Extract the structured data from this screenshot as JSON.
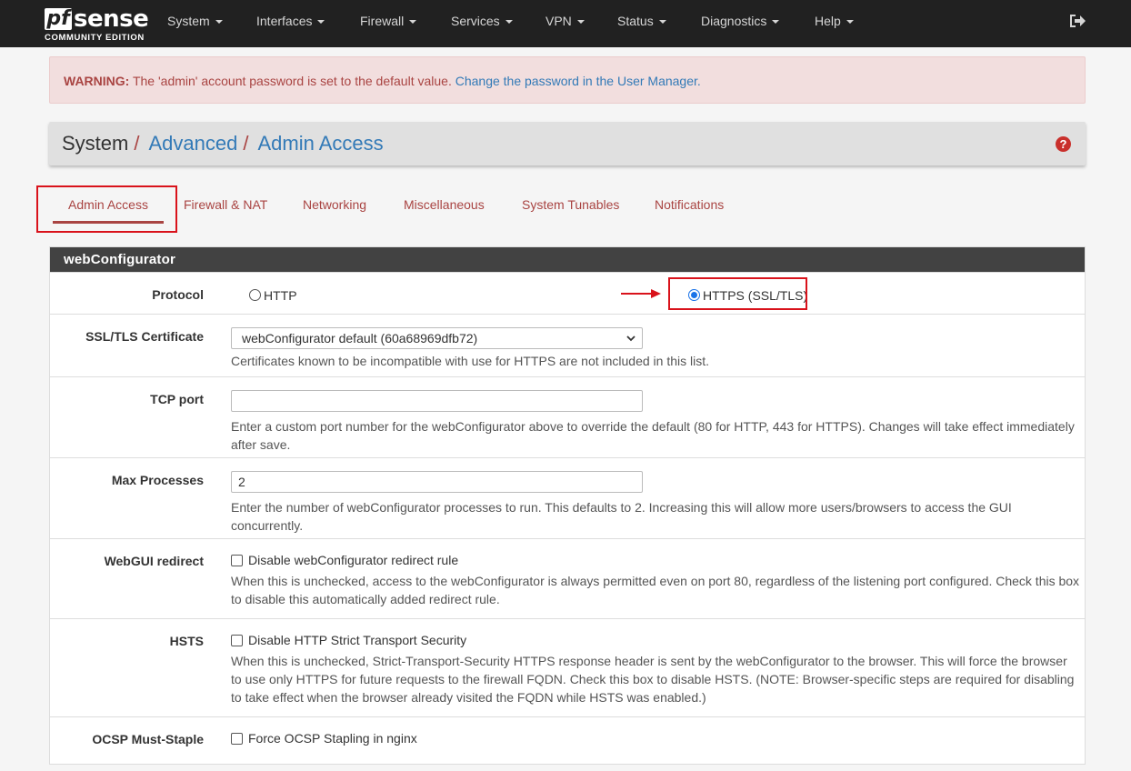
{
  "nav": {
    "logo_text": "sense",
    "logo_mark": "pf",
    "logo_edition": "COMMUNITY EDITION",
    "menu": [
      "System",
      "Interfaces",
      "Firewall",
      "Services",
      "VPN",
      "Status",
      "Diagnostics",
      "Help"
    ],
    "logout_icon": "sign-out-icon"
  },
  "alert": {
    "label": "WARNING:",
    "message": " The 'admin' account password is set to the default value. ",
    "link": "Change the password in the User Manager."
  },
  "breadcrumb": {
    "root": "System",
    "sep": "/",
    "level1": "Advanced",
    "level2": "Admin Access",
    "help_icon": "?"
  },
  "tabs": [
    "Admin Access",
    "Firewall & NAT",
    "Networking",
    "Miscellaneous",
    "System Tunables",
    "Notifications"
  ],
  "panel": {
    "title": "webConfigurator",
    "protocol": {
      "label": "Protocol",
      "options": [
        "HTTP",
        "HTTPS (SSL/TLS)"
      ],
      "selected": "HTTPS (SSL/TLS)"
    },
    "cert": {
      "label": "SSL/TLS Certificate",
      "value": "webConfigurator default (60a68969dfb72)",
      "help": "Certificates known to be incompatible with use for HTTPS are not included in this list."
    },
    "tcp_port": {
      "label": "TCP port",
      "value": "",
      "help": "Enter a custom port number for the webConfigurator above to override the default (80 for HTTP, 443 for HTTPS). Changes will take effect immediately after save."
    },
    "max_processes": {
      "label": "Max Processes",
      "value": "2",
      "help": "Enter the number of webConfigurator processes to run. This defaults to 2. Increasing this will allow more users/browsers to access the GUI concurrently."
    },
    "redirect": {
      "label": "WebGUI redirect",
      "checkbox": "Disable webConfigurator redirect rule",
      "help": "When this is unchecked, access to the webConfigurator is always permitted even on port 80, regardless of the listening port configured. Check this box to disable this automatically added redirect rule."
    },
    "hsts": {
      "label": "HSTS",
      "checkbox": "Disable HTTP Strict Transport Security",
      "help": "When this is unchecked, Strict-Transport-Security HTTPS response header is sent by the webConfigurator to the browser. This will force the browser to use only HTTPS for future requests to the firewall FQDN. Check this box to disable HSTS. (NOTE: Browser-specific steps are required for disabling to take effect when the browser already visited the FQDN while HSTS was enabled.)"
    },
    "ocsp": {
      "label": "OCSP Must-Staple",
      "checkbox": "Force OCSP Stapling in nginx"
    }
  },
  "colors": {
    "navbar": "#212121",
    "accent": "#a94442",
    "link": "#337ab7",
    "highlight": "#d9121b"
  }
}
